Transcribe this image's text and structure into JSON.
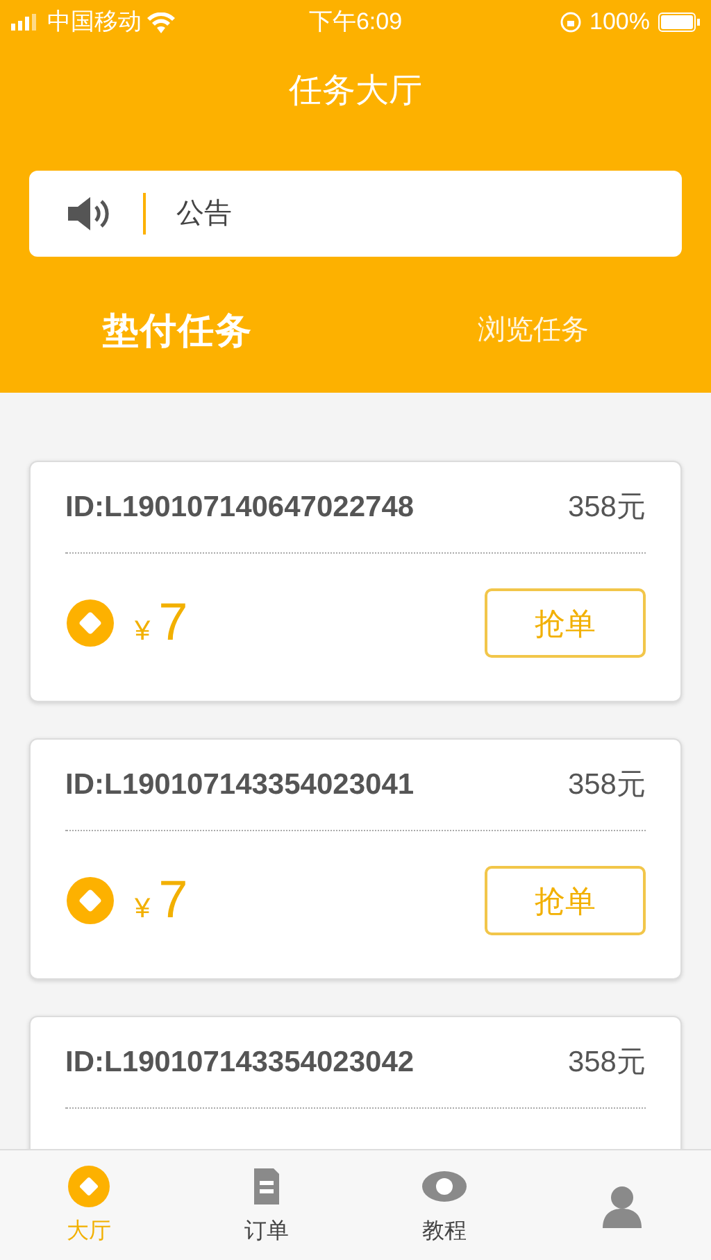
{
  "status_bar": {
    "carrier": "中国移动",
    "time": "下午6:09",
    "battery": "100%"
  },
  "title": "任务大厅",
  "notice": {
    "label": "公告"
  },
  "tabs": [
    {
      "label": "垫付任务",
      "selected": true
    },
    {
      "label": "浏览任务",
      "selected": false
    }
  ],
  "tasks": [
    {
      "id": "ID:L190107140647022748",
      "price": "358元",
      "currency": "¥",
      "reward": "7",
      "action": "抢单"
    },
    {
      "id": "ID:L190107143354023041",
      "price": "358元",
      "currency": "¥",
      "reward": "7",
      "action": "抢单"
    },
    {
      "id": "ID:L190107143354023042",
      "price": "358元"
    }
  ],
  "tab_bar": [
    {
      "label": "大厅",
      "kind": "hall",
      "selected": true
    },
    {
      "label": "订单",
      "kind": "orders",
      "selected": false
    },
    {
      "label": "教程",
      "kind": "tutorial",
      "selected": false
    },
    {
      "kind": "profile",
      "selected": false
    }
  ]
}
